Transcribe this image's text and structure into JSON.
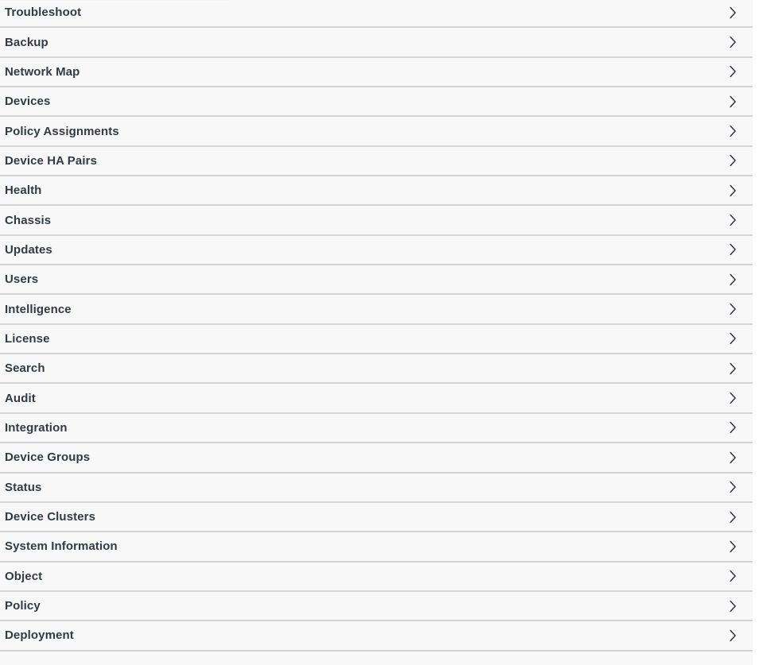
{
  "panel": {
    "name": "api-resource-list",
    "background_color": "#ffffff",
    "row_background_color": "#f8f8f9",
    "row_separator_color": "#d3d4d6",
    "label_color": "#333a45",
    "chevron_color": "#2b2f36"
  },
  "rows": [
    {
      "label": "Troubleshoot",
      "icon": "chevron-right-icon"
    },
    {
      "label": "Backup",
      "icon": "chevron-right-icon"
    },
    {
      "label": "Network Map",
      "icon": "chevron-right-icon"
    },
    {
      "label": "Devices",
      "icon": "chevron-right-icon"
    },
    {
      "label": "Policy Assignments",
      "icon": "chevron-right-icon"
    },
    {
      "label": "Device HA Pairs",
      "icon": "chevron-right-icon"
    },
    {
      "label": "Health",
      "icon": "chevron-right-icon"
    },
    {
      "label": "Chassis",
      "icon": "chevron-right-icon"
    },
    {
      "label": "Updates",
      "icon": "chevron-right-icon"
    },
    {
      "label": "Users",
      "icon": "chevron-right-icon"
    },
    {
      "label": "Intelligence",
      "icon": "chevron-right-icon"
    },
    {
      "label": "License",
      "icon": "chevron-right-icon"
    },
    {
      "label": "Search",
      "icon": "chevron-right-icon"
    },
    {
      "label": "Audit",
      "icon": "chevron-right-icon"
    },
    {
      "label": "Integration",
      "icon": "chevron-right-icon"
    },
    {
      "label": "Device Groups",
      "icon": "chevron-right-icon"
    },
    {
      "label": "Status",
      "icon": "chevron-right-icon"
    },
    {
      "label": "Device Clusters",
      "icon": "chevron-right-icon"
    },
    {
      "label": "System Information",
      "icon": "chevron-right-icon"
    },
    {
      "label": "Object",
      "icon": "chevron-right-icon"
    },
    {
      "label": "Policy",
      "icon": "chevron-right-icon"
    },
    {
      "label": "Deployment",
      "icon": "chevron-right-icon"
    }
  ]
}
